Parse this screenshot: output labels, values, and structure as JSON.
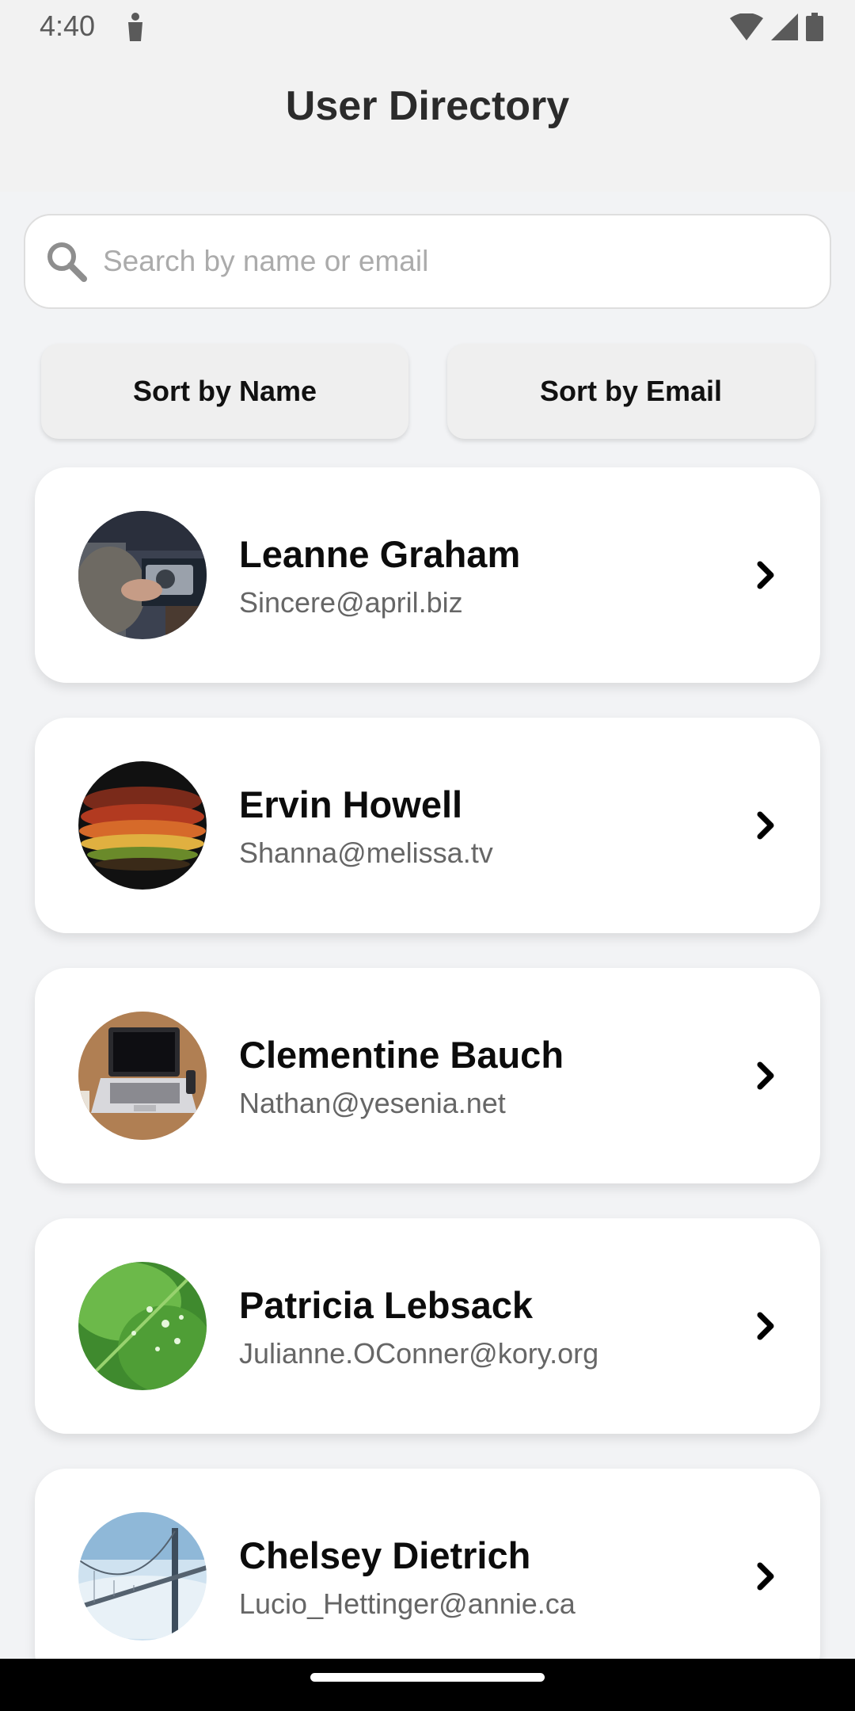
{
  "status_bar": {
    "time": "4:40",
    "icons": [
      "person-icon",
      "wifi-icon",
      "signal-icon",
      "battery-icon"
    ]
  },
  "header": {
    "title": "User Directory"
  },
  "search": {
    "placeholder": "Search by name or email",
    "value": "",
    "icon": "search-icon"
  },
  "sort": {
    "by_name_label": "Sort by Name",
    "by_email_label": "Sort by Email"
  },
  "users": [
    {
      "name": "Leanne Graham",
      "email": "Sincere@april.biz",
      "avatar": "camera-photo"
    },
    {
      "name": "Ervin Howell",
      "email": "Shanna@melissa.tv",
      "avatar": "food-photo"
    },
    {
      "name": "Clementine Bauch",
      "email": "Nathan@yesenia.net",
      "avatar": "laptop-photo"
    },
    {
      "name": "Patricia Lebsack",
      "email": "Julianne.OConner@kory.org",
      "avatar": "leaf-photo"
    },
    {
      "name": "Chelsey Dietrich",
      "email": "Lucio_Hettinger@annie.ca",
      "avatar": "bridge-photo"
    }
  ],
  "colors": {
    "background": "#f2f3f5",
    "card": "#ffffff",
    "sort_button": "#efefef",
    "title_text": "#2b2b2b",
    "email_text": "#666666",
    "placeholder_text": "#ababab"
  }
}
